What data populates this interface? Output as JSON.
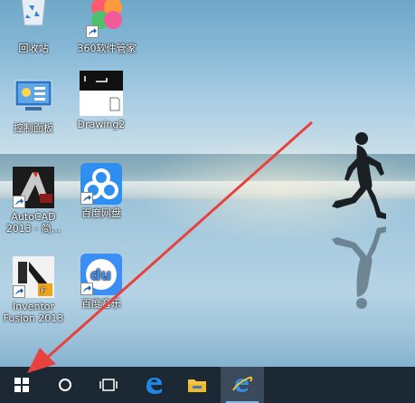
{
  "desktop": {
    "icons": [
      {
        "name": "recycle-bin",
        "label": "回收站",
        "icon": "recycle-bin-icon"
      },
      {
        "name": "360-security",
        "label": "360软件管家",
        "icon": "360-software-icon"
      },
      {
        "name": "control-panel",
        "label": "控制面板",
        "icon": "control-panel-icon"
      },
      {
        "name": "drawing2",
        "label": "Drawing2",
        "icon": "drawing-file-icon"
      },
      {
        "name": "autocad-2013",
        "label": "AutoCAD 2013 - 简...",
        "label_lines": [
          "AutoCAD",
          "2013 - 简..."
        ],
        "icon": "autocad-icon"
      },
      {
        "name": "baidu-netdisk",
        "label": "百度网盘",
        "icon": "baidu-netdisk-icon"
      },
      {
        "name": "inventor-fusion-2013",
        "label": "Inventor Fusion 2013",
        "label_lines": [
          "Inventor",
          "Fusion 2013"
        ],
        "icon": "inventor-fusion-icon"
      },
      {
        "name": "baidu-music",
        "label": "百度音乐",
        "icon": "baidu-music-icon"
      }
    ]
  },
  "taskbar": {
    "buttons": [
      {
        "name": "start-button",
        "icon": "windows-logo-icon"
      },
      {
        "name": "cortana-search-button",
        "icon": "cortana-circle-icon"
      },
      {
        "name": "task-view-button",
        "icon": "task-view-icon"
      },
      {
        "name": "edge-button",
        "icon": "edge-icon"
      },
      {
        "name": "file-explorer-button",
        "icon": "folder-icon"
      },
      {
        "name": "internet-explorer-button",
        "icon": "ie-icon",
        "active": true
      }
    ]
  },
  "colors": {
    "taskbar_bg": "#1c2834",
    "arrow": "#e8423f",
    "windows_logo": "#ffffff",
    "edge_blue": "#1e88e5",
    "ie_blue": "#2f8fe0",
    "baidu_blue": "#3c8ef5"
  }
}
